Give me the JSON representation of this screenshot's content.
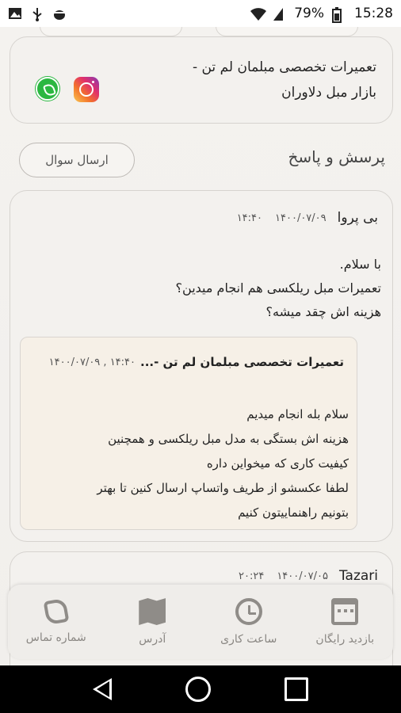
{
  "status_bar": {
    "battery": "79%",
    "time": "15:28",
    "icons": [
      "image-icon",
      "usb-icon",
      "android-debug-icon",
      "wifi-icon",
      "signal-icon",
      "battery-icon"
    ]
  },
  "shop": {
    "name_line1": "تعمیرات تخصصی مبلمان لم تن -",
    "name_line2": "بازار مبل دلاوران",
    "social": [
      "instagram-icon",
      "whatsapp-icon"
    ]
  },
  "qa": {
    "title": "پرسش و پاسخ",
    "ask_button": "ارسال سوال"
  },
  "questions": [
    {
      "author": "بی پروا",
      "date": "۱۴۰۰/۰۷/۰۹",
      "time": "۱۴:۴۰",
      "lines": [
        "با سلام.",
        "تعمیرات مبل ریلکسی هم انجام میدین؟",
        "هزینه اش چقد میشه؟"
      ],
      "answer": {
        "name": "تعمیرات تخصصی مبلمان لم تن -...",
        "meta": "۱۴۰۰/۰۷/۰۹ , ۱۴:۴۰",
        "lines": [
          "سلام بله انجام میدیم",
          "هزینه اش بستگی به مدل مبل ریلکسی و همچنین",
          "کیفیت کاری که میخواین داره",
          "لطفا عکسشو از طریف واتساپ ارسال کنین تا بهتر",
          "بتونیم راهنماییتون کنیم"
        ]
      }
    },
    {
      "author": "Tazari",
      "date": "۱۴۰۰/۰۷/۰۵",
      "time": "۲۰:۲۴"
    }
  ],
  "bottom_nav": [
    {
      "label": "شماره تماس",
      "icon": "phone-icon"
    },
    {
      "label": "آدرس",
      "icon": "map-icon"
    },
    {
      "label": "ساعت کاری",
      "icon": "clock-icon"
    },
    {
      "label": "بازدید رایگان",
      "icon": "calendar-icon"
    }
  ],
  "colors": {
    "background": "#f2f0ed",
    "card": "#f3f1ee",
    "answer_card": "#f6f0e7",
    "nav_icon": "#8f8c88"
  }
}
